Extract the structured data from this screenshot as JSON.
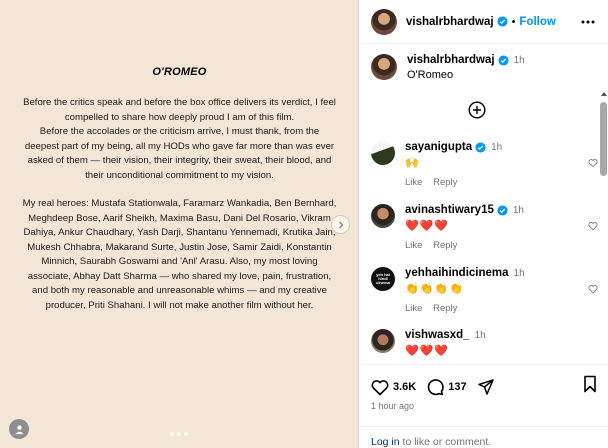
{
  "post": {
    "title": "O'ROMEO",
    "paragraphs": [
      "Before the critics speak and before the box office delivers its verdict, I feel compelled to share how deeply proud I am of this film.",
      "Before the accolades or the criticism arrive, I must thank, from the deepest part of my being, all my HODs who gave far more than was ever asked of them — their vision, their integrity, their sweat, their blood, and their unconditional commitment to my vision.",
      "My real heroes: Mustafa Stationwala, Faramarz Wankadia, Ben Bernhard, Meghdeep Bose, Aarif Sheikh, Maxima Basu, Dani Del Rosario, Vikram Dahiya, Ankur Chaudhary, Yash Darji, Shantanu Yennemadi, Krutika Jain, Mukesh Chhabra, Makarand Surte, Justin Jose, Samir Zaidi, Konstantin Minnich, Saurabh Goswami and 'Anl' Arasu. Also, my most loving associate, Abhay Datt Sharma — who shared my love, pain, frustration, and both my reasonable and unreasonable whims — and my creative producer, Priti Shahani. I will not make another film without her."
    ]
  },
  "header": {
    "username": "vishalrbhardwaj",
    "separator": "•",
    "follow_label": "Follow"
  },
  "caption": {
    "username": "vishalrbhardwaj",
    "time": "1h",
    "text": "O'Romeo"
  },
  "comments": [
    {
      "username": "sayanigupta",
      "time": "1h",
      "text": "🙌",
      "like": "Like",
      "reply": "Reply"
    },
    {
      "username": "avinashtiwary15",
      "time": "1h",
      "text": "❤️❤️❤️",
      "like": "Like",
      "reply": "Reply"
    },
    {
      "username": "yehhaihindicinema",
      "time": "1h",
      "text": "👏👏👏👏",
      "like": "Like",
      "reply": "Reply"
    },
    {
      "username": "vishwasxd_",
      "time": "1h",
      "text": "❤️❤️❤️",
      "like": "",
      "reply": ""
    }
  ],
  "yeh_avatar_text": "yeh hai hindi cinema",
  "footer": {
    "likes_count": "3.6K",
    "comments_count": "137",
    "posted_ago": "1 hour ago",
    "login_link": "Log in",
    "login_rest": " to like or comment."
  },
  "colors": {
    "accent": "#0095f6",
    "verified": "#0095f6",
    "post_bg": "#f3e6d6"
  }
}
